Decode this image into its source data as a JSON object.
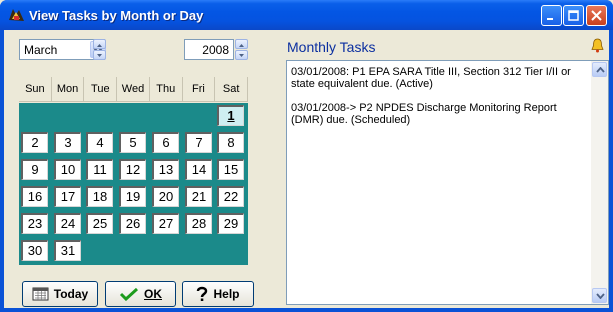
{
  "window": {
    "title": "View Tasks by Month or Day"
  },
  "selector": {
    "month": "March",
    "year": "2008"
  },
  "calendar": {
    "weekdays": [
      "Sun",
      "Mon",
      "Tue",
      "Wed",
      "Thu",
      "Fri",
      "Sat"
    ],
    "days": [
      "1",
      "2",
      "3",
      "4",
      "5",
      "6",
      "7",
      "8",
      "9",
      "10",
      "11",
      "12",
      "13",
      "14",
      "15",
      "16",
      "17",
      "18",
      "19",
      "20",
      "21",
      "22",
      "23",
      "24",
      "25",
      "26",
      "27",
      "28",
      "29",
      "30",
      "31"
    ],
    "first_weekday_index": 6,
    "selected_day": "1",
    "colors": {
      "grid": "#1b8a8a",
      "selected": "#cfeef2"
    }
  },
  "buttons": {
    "today": "Today",
    "ok": "OK",
    "help": "Help"
  },
  "tasks": {
    "title": "Monthly Tasks",
    "entries": [
      "03/01/2008:  P1  EPA SARA Title III, Section 312 Tier I/II or state equivalent due. (Active)",
      "03/01/2008-> P2  NPDES Discharge Monitoring Report (DMR) due. (Scheduled)"
    ]
  },
  "icons": {
    "title": "app-icon",
    "bell": "bell-icon",
    "today": "calendar-icon",
    "ok": "checkmark-icon",
    "help": "question-icon"
  }
}
